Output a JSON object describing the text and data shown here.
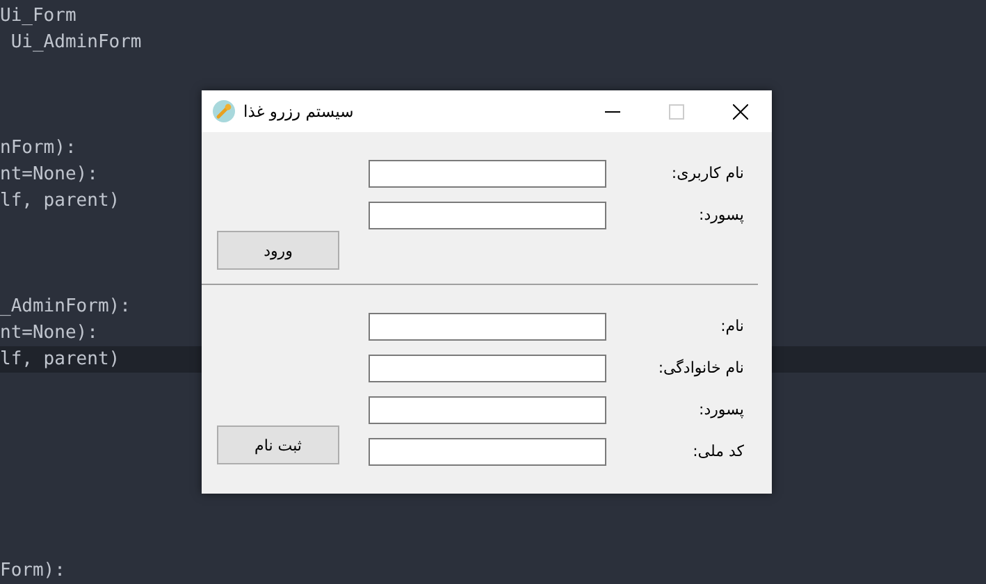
{
  "editor": {
    "lines": [
      {
        "text": "Ui_Form",
        "current": false
      },
      {
        "text": " Ui_AdminForm",
        "current": false
      },
      {
        "text": "nForm):",
        "current": false
      },
      {
        "text": "nt=None):",
        "current": false
      },
      {
        "text": "lf, parent)",
        "current": false
      },
      {
        "text": "_AdminForm):",
        "current": false
      },
      {
        "text": "nt=None):",
        "current": false
      },
      {
        "text": "lf, parent)",
        "current": true
      },
      {
        "text": "Form):",
        "current": false
      }
    ]
  },
  "window": {
    "title": "سیستم رزرو غذا",
    "sections": [
      {
        "fields": [
          {
            "label": "نام کاربری:"
          },
          {
            "label": "پسورد:"
          }
        ],
        "button": "ورود"
      },
      {
        "fields": [
          {
            "label": "نام:"
          },
          {
            "label": "نام خانوادگی:"
          },
          {
            "label": "پسورد:"
          },
          {
            "label": "کد ملی:"
          }
        ],
        "button": "ثبت نام"
      }
    ]
  }
}
